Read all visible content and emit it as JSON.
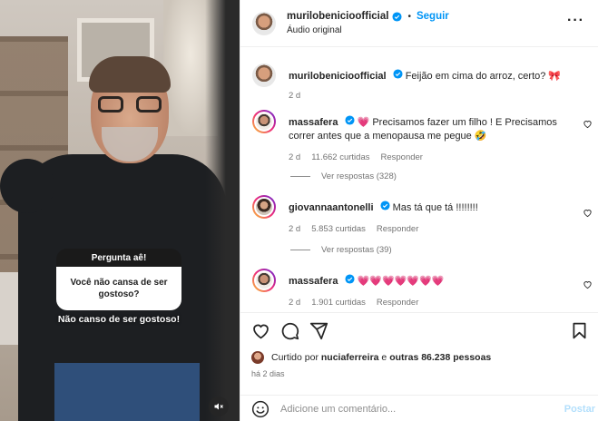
{
  "story": {
    "question_header": "Pergunta aê!",
    "question_text": "Você não cansa de ser gostoso?",
    "answer_text": "Não canso de ser gostoso!"
  },
  "post": {
    "author": "murilobenicioofficial",
    "follow_label": "Seguir",
    "audio_label": "Áudio original",
    "more_icon": "more-options-icon"
  },
  "caption": {
    "username": "murilobenicioofficial",
    "text": "Feijão em cima do arroz, certo? 🎀",
    "time": "2 d"
  },
  "comments": [
    {
      "username": "massafera",
      "text": "💗 Precisamos fazer um filho ! E Precisamos correr antes que a menopausa me pegue 🤣",
      "time": "2 d",
      "likes": "11.662 curtidas",
      "reply_label": "Responder",
      "view_replies": "Ver respostas (328)"
    },
    {
      "username": "giovannaantonelli",
      "text": "Mas tá que tá !!!!!!!!",
      "time": "2 d",
      "likes": "5.853 curtidas",
      "reply_label": "Responder",
      "view_replies": "Ver respostas (39)"
    },
    {
      "username": "massafera",
      "text": "💗💗💗💗💗💗💗",
      "time": "2 d",
      "likes": "1.901 curtidas",
      "reply_label": "Responder"
    }
  ],
  "likes_summary": {
    "prefix": "Curtido por",
    "user": "nuciaferreira",
    "middle": "e",
    "others": "outras 86.238 pessoas"
  },
  "posted_ago": "há 2 dias",
  "comment_box": {
    "placeholder": "Adicione um comentário...",
    "post_label": "Postar"
  },
  "colors": {
    "link_blue": "#0095f6",
    "post_disabled": "#b2dffc",
    "verified_blue": "#0095f6",
    "heart_red": "#ed4956",
    "muted_text": "#737373"
  }
}
